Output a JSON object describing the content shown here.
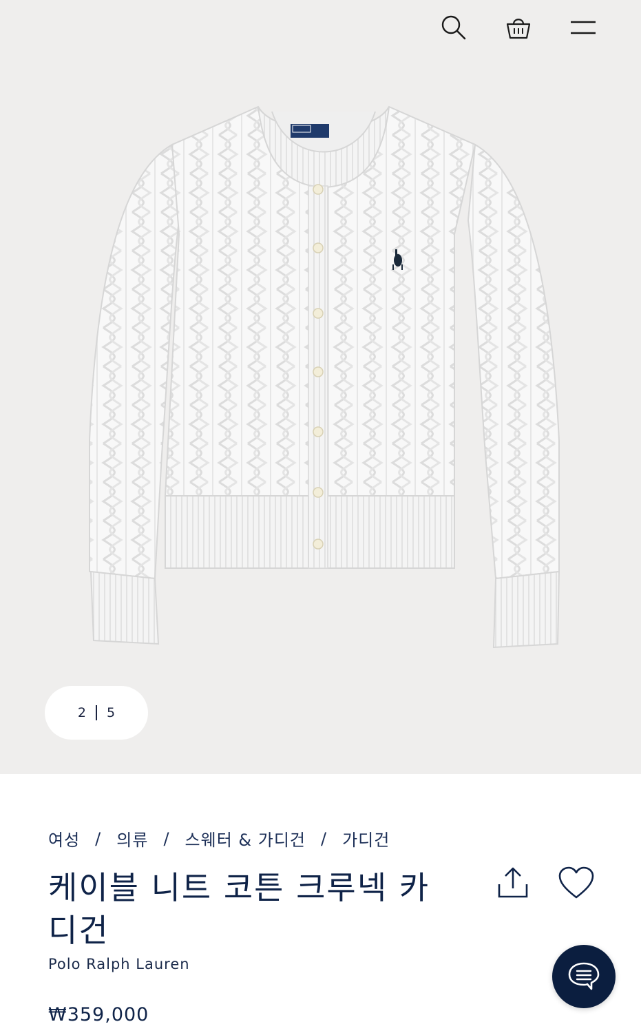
{
  "header": {
    "icons": [
      "search-icon",
      "shopping-bag-icon",
      "menu-icon"
    ]
  },
  "gallery": {
    "current": "2",
    "total": "5",
    "image_alt": "cable knit cardigan"
  },
  "product": {
    "breadcrumb": [
      "여성",
      "의류",
      "스웨터 & 가디건",
      "가디건"
    ],
    "breadcrumb_sep": "/",
    "title": "케이블 니트 코튼 크루넥 카디건",
    "brand": "Polo Ralph Lauren",
    "price": "₩359,000"
  },
  "colors": {
    "navy": "#0f2348",
    "hero_bg": "#efeeed",
    "chat_bg": "#0b1e3f"
  }
}
